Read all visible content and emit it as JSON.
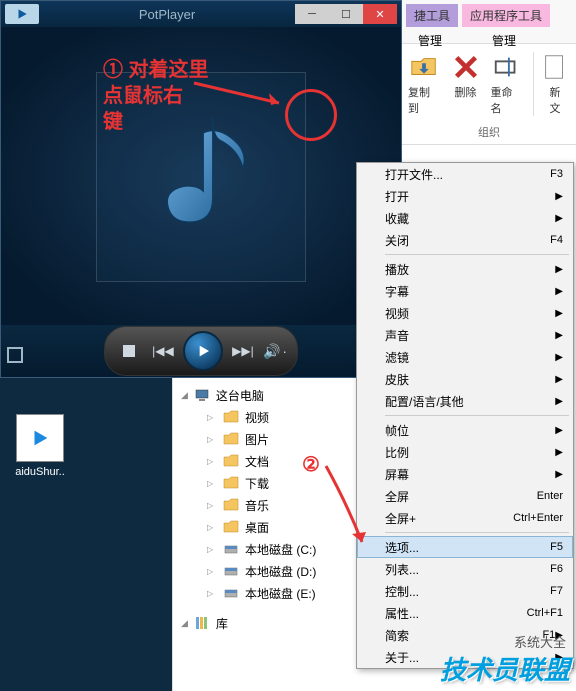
{
  "titlebar": {
    "title": "PotPlayer"
  },
  "annotation1": {
    "line1": "① 对着这里",
    "line2": "点鼠标右",
    "line3": "键"
  },
  "annotation2": "②",
  "ribbon": {
    "tab1": "捷工具",
    "tab2": "应用程序工具",
    "tab3": "管理",
    "tab4": "管理",
    "btn_copy": "复制到",
    "btn_delete": "删除",
    "btn_rename": "重命名",
    "btn_new": "新\n文",
    "group_label": "组织"
  },
  "menu": {
    "items": [
      {
        "label": "打开文件...",
        "shortcut": "F3",
        "arrow": false
      },
      {
        "label": "打开",
        "arrow": true
      },
      {
        "label": "收藏",
        "arrow": true
      },
      {
        "label": "关闭",
        "shortcut": "F4"
      },
      {
        "sep": true
      },
      {
        "label": "播放",
        "arrow": true
      },
      {
        "label": "字幕",
        "arrow": true
      },
      {
        "label": "视频",
        "arrow": true
      },
      {
        "label": "声音",
        "arrow": true
      },
      {
        "label": "滤镜",
        "arrow": true
      },
      {
        "label": "皮肤",
        "arrow": true
      },
      {
        "label": "配置/语言/其他",
        "arrow": true
      },
      {
        "sep": true
      },
      {
        "label": "帧位",
        "arrow": true
      },
      {
        "label": "比例",
        "arrow": true
      },
      {
        "label": "屏幕",
        "arrow": true
      },
      {
        "label": "全屏",
        "shortcut": "Enter"
      },
      {
        "label": "全屏+",
        "shortcut": "Ctrl+Enter"
      },
      {
        "sep": true
      },
      {
        "label": "选项...",
        "shortcut": "F5",
        "highlight": true
      },
      {
        "label": "列表...",
        "shortcut": "F6"
      },
      {
        "label": "控制...",
        "shortcut": "F7"
      },
      {
        "label": "属性...",
        "shortcut": "Ctrl+F1"
      },
      {
        "label": "简索",
        "shortcut": "F1",
        "arrow": true
      },
      {
        "label": "关于...",
        "arrow": true
      }
    ]
  },
  "desktop_icon_label": "aiduShur..",
  "explorer": {
    "root": "这台电脑",
    "items": [
      "视频",
      "图片",
      "文档",
      "下载",
      "音乐",
      "桌面",
      "本地磁盘 (C:)",
      "本地磁盘 (D:)",
      "本地磁盘 (E:)"
    ],
    "lib": "库"
  },
  "watermark": "技术员联盟",
  "watermark_sub": "系统大全"
}
